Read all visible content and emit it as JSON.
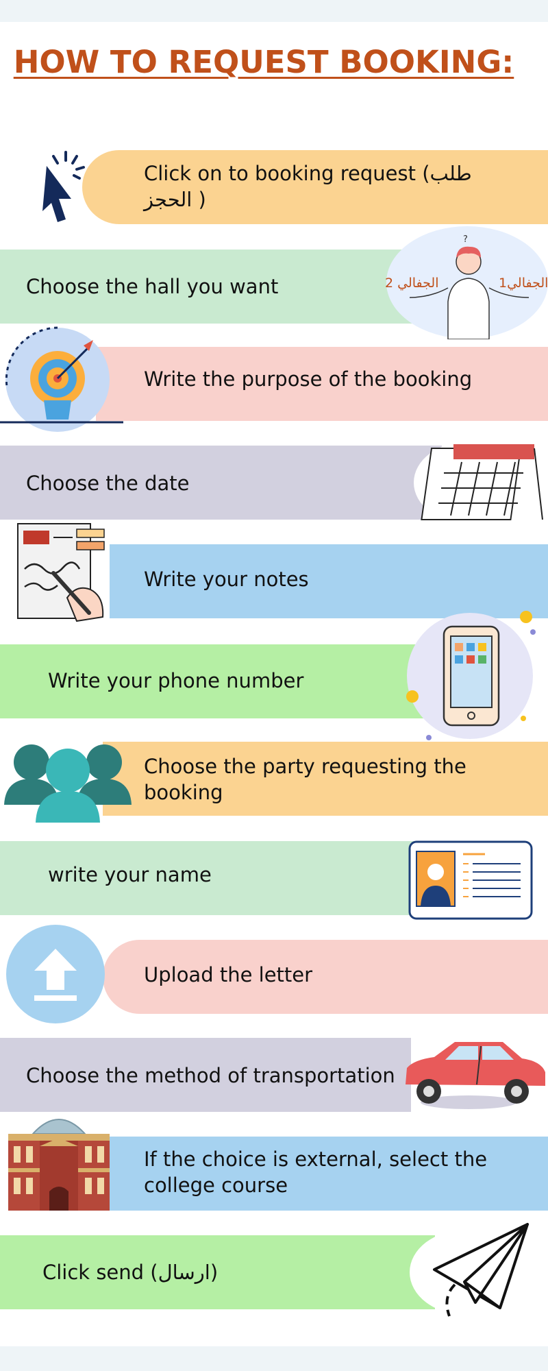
{
  "title": "HOW TO REQUEST BOOKING:",
  "steps": [
    {
      "text": "Click on to booking request (طلب الحجز )",
      "color": "#fbd391",
      "icon": "cursor-click-icon"
    },
    {
      "text": "Choose the hall you want",
      "color": "#c9ead0",
      "icon": "confused-person-icon",
      "labels": [
        "الجفالي 2",
        "الجفالي1"
      ],
      "question": "?"
    },
    {
      "text": "Write the purpose of the booking",
      "color": "#f9d1cc",
      "icon": "idea-target-bulb-icon"
    },
    {
      "text": "Choose the date",
      "color": "#d2d0df",
      "icon": "calendar-icon"
    },
    {
      "text": "Write your notes",
      "color": "#a6d2f0",
      "icon": "writing-hand-icon"
    },
    {
      "text": "Write your phone number",
      "color": "#b5efa4",
      "icon": "smartphone-icon"
    },
    {
      "text": "Choose the party requesting the booking",
      "color": "#fbd391",
      "icon": "group-people-icon"
    },
    {
      "text": "write your name",
      "color": "#c9ead0",
      "icon": "id-card-icon"
    },
    {
      "text": "Upload the letter",
      "color": "#f9d1cc",
      "icon": "upload-icon"
    },
    {
      "text": "Choose the method of transportation",
      "color": "#d2d0df",
      "icon": "car-icon"
    },
    {
      "text": "If the choice is external, select the college course",
      "color": "#a6d2f0",
      "icon": "college-building-icon"
    },
    {
      "text": "Click send (ارسال)",
      "color": "#b5efa4",
      "icon": "paper-plane-icon"
    }
  ]
}
